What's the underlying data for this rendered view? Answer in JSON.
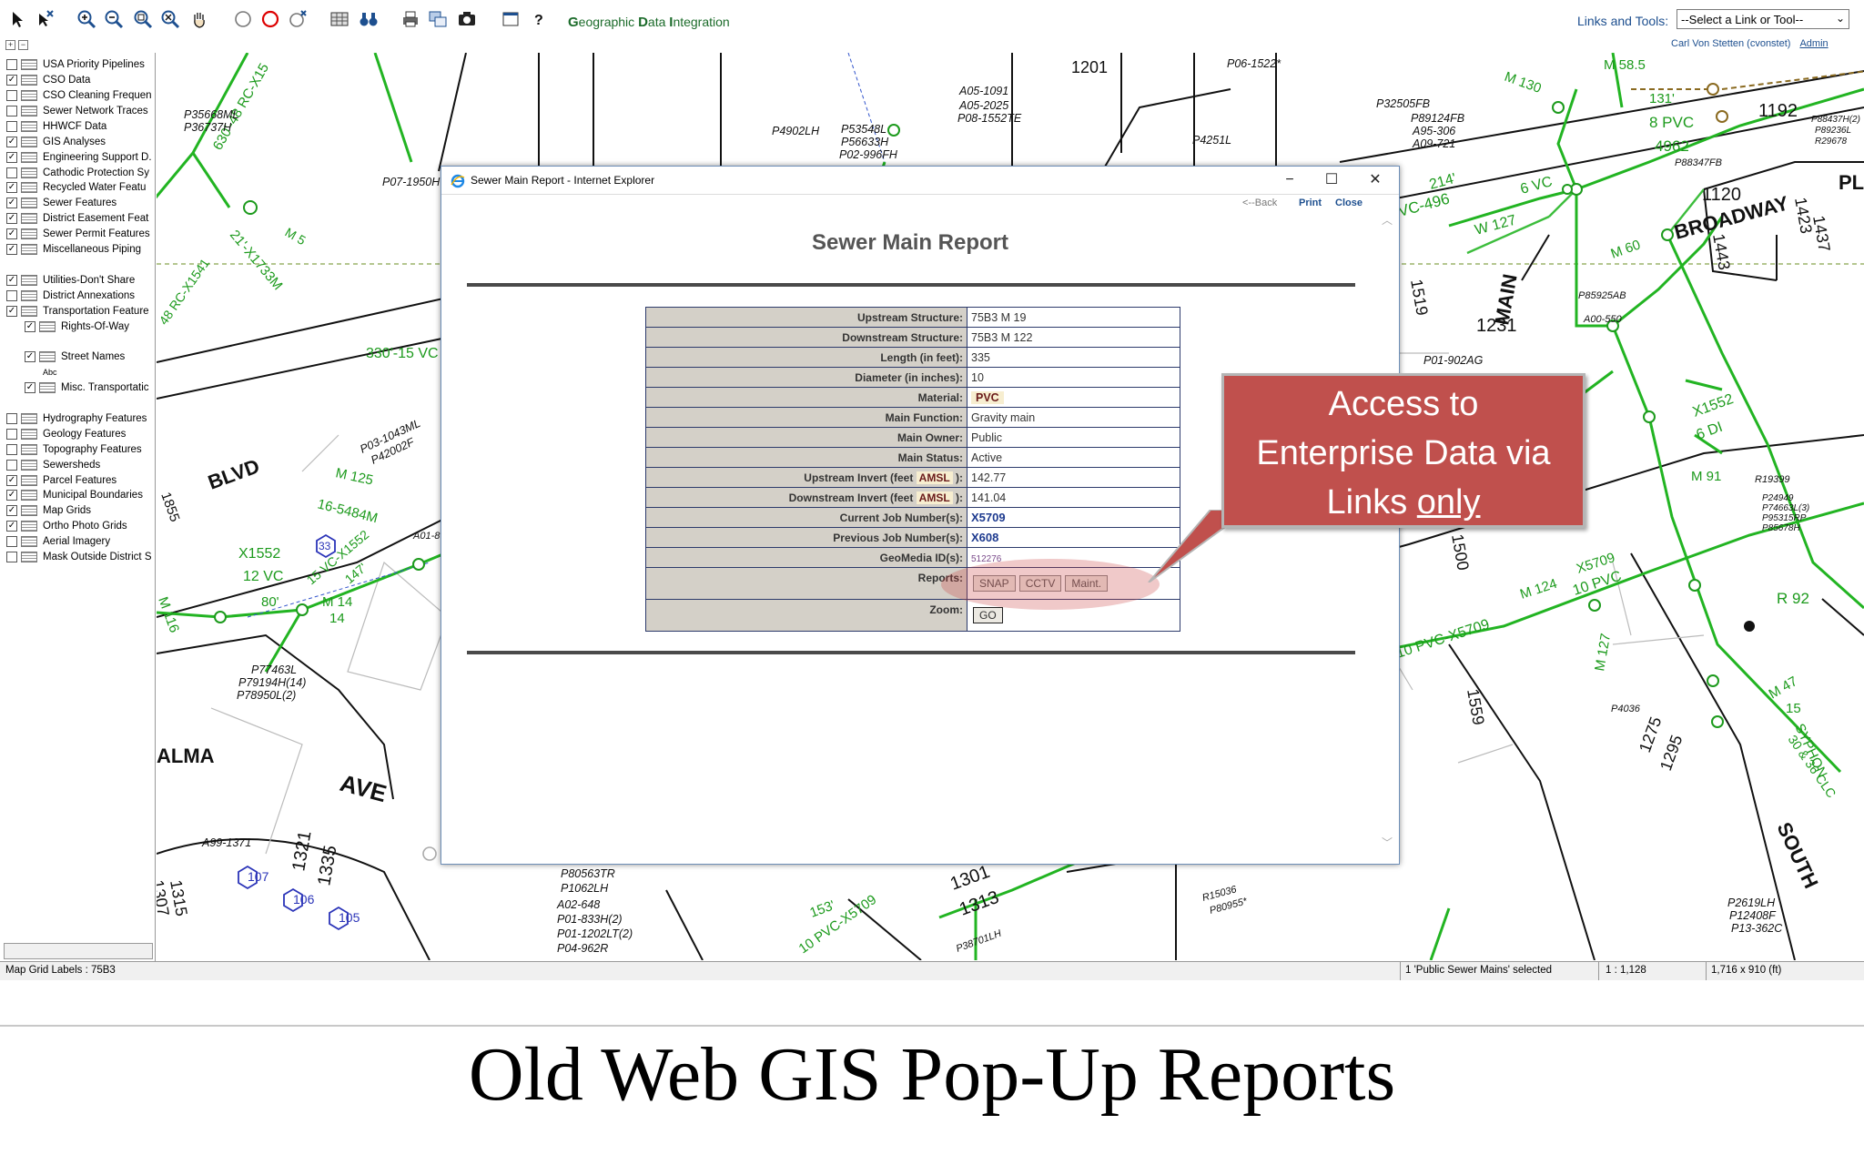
{
  "app": {
    "title_g": "G",
    "title_rest1": "eographic ",
    "title_d": "D",
    "title_rest2": "ata ",
    "title_i": "I",
    "title_rest3": "ntegration",
    "links_label": "Links and Tools:",
    "links_select": "--Select a Link or Tool--",
    "user": "Carl Von Stetten (cvonstet)",
    "admin_link": "Admin"
  },
  "toolbar_icons": [
    "select-arrow-icon",
    "select-clear-icon",
    "zoom-in-icon",
    "zoom-out-icon",
    "zoom-extent-icon",
    "zoom-clear-icon",
    "pan-hand-icon",
    "circle-select-icon",
    "circle-red-icon",
    "circle-clear-icon",
    "grid-icon",
    "binoculars-icon",
    "print-icon",
    "layers-print-icon",
    "camera-icon",
    "window-icon",
    "help-icon"
  ],
  "layers": [
    {
      "name": "USA Priority Pipelines",
      "checked": false
    },
    {
      "name": "CSO Data",
      "checked": true
    },
    {
      "name": "CSO Cleaning Frequen",
      "checked": false
    },
    {
      "name": "Sewer Network Traces",
      "checked": false
    },
    {
      "name": "HHWCF Data",
      "checked": false
    },
    {
      "name": "GIS Analyses",
      "checked": true
    },
    {
      "name": "Engineering Support D.",
      "checked": true
    },
    {
      "name": "Cathodic Protection Sy",
      "checked": false
    },
    {
      "name": "Recycled Water Featu",
      "checked": true
    },
    {
      "name": "Sewer Features",
      "checked": true
    },
    {
      "name": "District Easement Feat",
      "checked": true
    },
    {
      "name": "Sewer Permit Features",
      "checked": true
    },
    {
      "name": "Miscellaneous Piping",
      "checked": true
    },
    {
      "name": "Utilities-Don't Share",
      "checked": true
    },
    {
      "name": "District Annexations",
      "checked": false
    },
    {
      "name": "Transportation Feature",
      "checked": true
    },
    {
      "name": "Rights-Of-Way",
      "checked": true
    },
    {
      "name": "Street Names",
      "checked": true
    },
    {
      "name": "Abc",
      "checked": false
    },
    {
      "name": "Misc. Transportatic",
      "checked": true
    },
    {
      "name": "Hydrography Features",
      "checked": false
    },
    {
      "name": "Geology Features",
      "checked": false
    },
    {
      "name": "Topography Features",
      "checked": false
    },
    {
      "name": "Sewersheds",
      "checked": false
    },
    {
      "name": "Parcel Features",
      "checked": true
    },
    {
      "name": "Municipal Boundaries",
      "checked": true
    },
    {
      "name": "Map Grids",
      "checked": true
    },
    {
      "name": "Ortho Photo Grids",
      "checked": true
    },
    {
      "name": "Aerial Imagery",
      "checked": false
    },
    {
      "name": "Mask Outside District S",
      "checked": false
    }
  ],
  "status": {
    "grid_labels": "Map Grid Labels : 75B3",
    "selected": "1 'Public Sewer Mains' selected",
    "scale": "1 : 1,128",
    "extent": "1,716 x 910 (ft)"
  },
  "map_labels": {
    "blvd": "BLVD",
    "ave": "AVE",
    "alma": "ALMA",
    "broadway": "BROADWAY",
    "main": "MAIN",
    "south": "SOUTH",
    "rc_x15": "630'-48 RC-X15",
    "rcx1541a": "21'-X1733M",
    "m5": "M 5",
    "rc48": "48 RC-X1541",
    "vc330": "330'-15 VC",
    "m125": "M 125",
    "vc1552": "16-5484M",
    "x1552": "X1552",
    "vc12": "12 VC",
    "m14": "M 14",
    "n14": "14",
    "n80": "80'",
    "n147": "147'",
    "vc15": "15 VC-X1552",
    "m116": "M 116",
    "n1855": "1855",
    "n1201": "1201",
    "n1192": "1192",
    "pvc8": "8 PVC",
    "n4962": "4962",
    "n1120": "1120",
    "n1231": "1231",
    "n1519": "1519",
    "n1500": "1500",
    "n1559": "1559",
    "n1275": "1275",
    "n1295": "1295",
    "n1301": "1301",
    "n1313": "1313",
    "n1321": "1321",
    "n1335": "1335",
    "n1315": "1315",
    "n1307": "1307",
    "n153": "153'",
    "pvc10": "10 PVC-X5709",
    "pvc10b": "10 PVC",
    "x5709": "X5709",
    "m124": "M 124",
    "m127": "M 127",
    "m47": "M 47",
    "n15": "15",
    "r92": "R 92",
    "x1552b": "X1552",
    "di6": "6 DI",
    "m91": "M 91",
    "m60": "M 60",
    "vc496": "VC-496",
    "w127": "W 127",
    "n214": "214'",
    "vc6": "6 VC",
    "syphon": "SYPHON",
    "clc": "30 & 36 CLC",
    "n1423": "1423",
    "n1437": "1437",
    "n1443": "1443",
    "pl": "PL",
    "m130": "M 130",
    "m585": "M 58.5",
    "n131": "131'",
    "n107": "107",
    "n106": "106",
    "n105": "105",
    "n33": "33",
    "parcel1": "P35668ML",
    "parcel2": "P36737H",
    "parcel3": "P07-1950H",
    "parcel4": "P4902LH",
    "parcel5": "P53548L",
    "parcel6": "P56633H",
    "parcel7": "P02-996FH",
    "parcel8": "A05-1091",
    "parcel9": "A05-2025",
    "parcel10": "P08-1552TE",
    "parcel11": "P06-1522*",
    "parcel12": "P32505FB",
    "parcel13": "P89124FB",
    "parcel14": "A95-306",
    "parcel15": "A09-721",
    "parcel16": "P4251L",
    "parcel17": "P88347FB",
    "parcel18": "P85925AB",
    "parcel19": "A00-550",
    "parcel20": "P01-902AG",
    "parcel21": "R19399",
    "parcel22": "P03-1043ML",
    "parcel23": "P42002F",
    "parcel24": "P77463L",
    "parcel25": "P79194H(14)",
    "parcel26": "P78950L(2)",
    "parcel27": "A99-1371",
    "parcel28": "P80563TR",
    "parcel29": "P1062LH",
    "parcel30": "A02-648",
    "parcel31": "P01-833H(2)",
    "parcel32": "P01-1202LT(2)",
    "parcel33": "P04-962R",
    "parcel34": "R15036",
    "parcel35": "P80955*",
    "parcel36": "P2619LH",
    "parcel37": "P12408F",
    "parcel38": "P13-362C",
    "parcel39": "P4036",
    "parcel40": "P38701LH",
    "parcel41": "P24949",
    "parcel42": "P74663L(3)",
    "parcel43": "P95315RP",
    "parcel44": "P85678H",
    "parcel45": "P88437H(2)",
    "parcel46": "P89236L",
    "parcel47": "R29678",
    "parcel48": "A01-8"
  },
  "popup": {
    "window_title": "Sewer Main Report - Internet Explorer",
    "nav_back": "<--Back",
    "nav_print": "Print",
    "nav_close": "Close",
    "report_title": "Sewer Main Report",
    "rows": [
      {
        "key": "Upstream Structure:",
        "value": "75B3 M 19"
      },
      {
        "key": "Downstream Structure:",
        "value": "75B3 M 122"
      },
      {
        "key": "Length (in feet):",
        "value": "335"
      },
      {
        "key": "Diameter (in inches):",
        "value": "10"
      },
      {
        "key": "Material:",
        "value": "PVC"
      },
      {
        "key": "Main Function:",
        "value": "Gravity main"
      },
      {
        "key": "Main Owner:",
        "value": "Public"
      },
      {
        "key": "Main Status:",
        "value": "Active"
      },
      {
        "key_pre": "Upstream Invert (feet ",
        "key_amsl": "AMSL",
        "key_post": " ):",
        "value": "142.77"
      },
      {
        "key_pre": "Downstream Invert (feet ",
        "key_amsl": "AMSL",
        "key_post": " ):",
        "value": "141.04"
      },
      {
        "key": "Current Job Number(s):",
        "value": "X5709"
      },
      {
        "key": "Previous Job Number(s):",
        "value": "X608"
      },
      {
        "key": "GeoMedia ID(s):",
        "value": "512276"
      }
    ],
    "reports_label": "Reports:",
    "report_buttons": [
      "SNAP",
      "CCTV",
      "Maint."
    ],
    "zoom_label": "Zoom:",
    "go_button": "GO"
  },
  "callout": {
    "line1": "Access to",
    "line2": "Enterprise Data via",
    "line3a": "Links ",
    "line3b": "only"
  },
  "caption": "Old Web GIS Pop-Up Reports"
}
